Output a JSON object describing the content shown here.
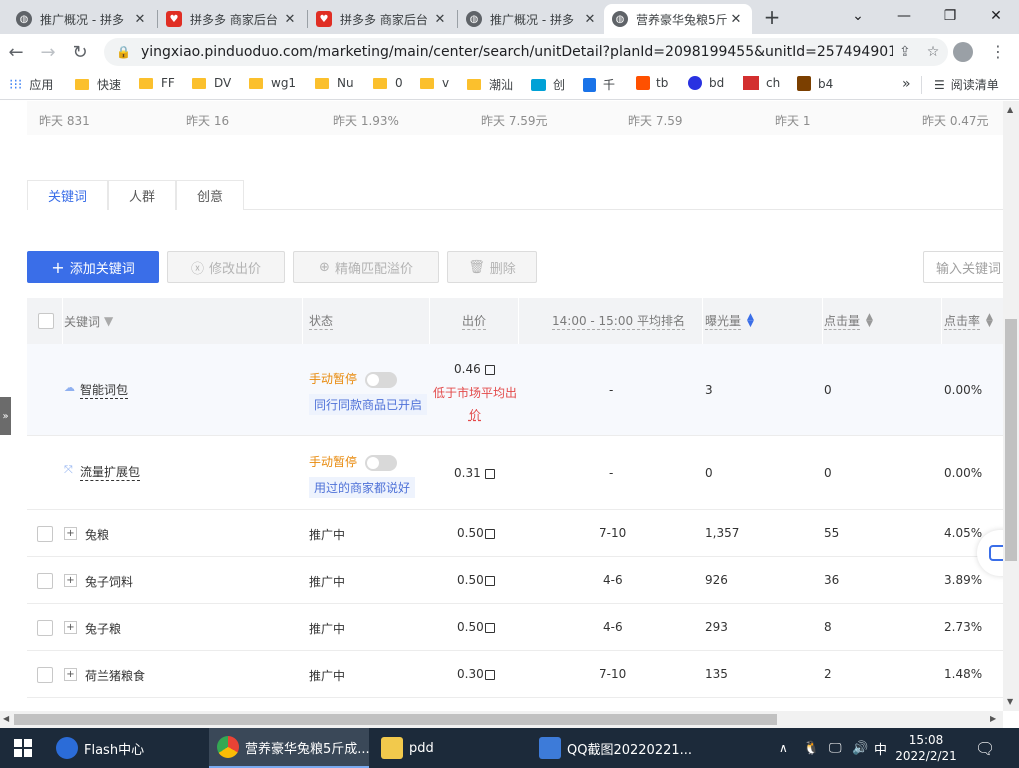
{
  "browser": {
    "tabs": [
      {
        "title": "推广概况 - 拼多",
        "icon": "globe-icon"
      },
      {
        "title": "拼多多 商家后台",
        "icon": "pinduoduo-icon"
      },
      {
        "title": "拼多多 商家后台",
        "icon": "pinduoduo-icon"
      },
      {
        "title": "推广概况 - 拼多",
        "icon": "globe-icon"
      },
      {
        "title": "营养豪华兔粮5斤",
        "icon": "globe-icon",
        "active": true
      }
    ],
    "new_tab": "+",
    "url": "yingxiao.pinduoduo.com/marketing/main/center/search/unitDetail?planId=2098199455&unitId=257494901...",
    "bookmarks": [
      "应用",
      "快速",
      "FF",
      "DV",
      "wg1",
      "Nu",
      "0",
      "v",
      "潮汕",
      "创",
      "千",
      "tb",
      "bd",
      "ch",
      "b4"
    ],
    "bookmarks_more": "»",
    "reading_list": "阅读清单"
  },
  "stats_row": [
    "昨天 831",
    "昨天 16",
    "昨天 1.93%",
    "昨天 7.59元",
    "昨天 7.59",
    "昨天 1",
    "昨天 0.47元"
  ],
  "content_tabs": [
    "关键词",
    "人群",
    "创意"
  ],
  "actions": {
    "add_keyword": "添加关键词",
    "edit_bid": "修改出价",
    "precise_match": "精确匹配溢价",
    "delete": "删除",
    "search_placeholder": "输入关键词"
  },
  "table": {
    "headers": {
      "keyword": "关键词",
      "status": "状态",
      "bid": "出价",
      "avg_rank": "14:00 - 15:00 平均排名",
      "impressions": "曝光量",
      "clicks": "点击量",
      "ctr": "点击率"
    },
    "special_rows": [
      {
        "name": "智能词包",
        "status": "手动暂停",
        "tag": "同行同款商品已开启",
        "bid": "0.46",
        "note_line1": "低于市场平均出",
        "note_line2": "价",
        "rank": "-",
        "impressions": "3",
        "clicks": "0",
        "ctr": "0.00%"
      },
      {
        "name": "流量扩展包",
        "status": "手动暂停",
        "tag": "用过的商家都说好",
        "bid": "0.31",
        "rank": "-",
        "impressions": "0",
        "clicks": "0",
        "ctr": "0.00%"
      }
    ],
    "rows": [
      {
        "name": "兔粮",
        "status": "推广中",
        "bid": "0.50",
        "rank": "7-10",
        "impressions": "1,357",
        "clicks": "55",
        "ctr": "4.05%"
      },
      {
        "name": "兔子饲料",
        "status": "推广中",
        "bid": "0.50",
        "rank": "4-6",
        "impressions": "926",
        "clicks": "36",
        "ctr": "3.89%"
      },
      {
        "name": "兔子粮",
        "status": "推广中",
        "bid": "0.50",
        "rank": "4-6",
        "impressions": "293",
        "clicks": "8",
        "ctr": "2.73%"
      },
      {
        "name": "荷兰猪粮食",
        "status": "推广中",
        "bid": "0.30",
        "rank": "7-10",
        "impressions": "135",
        "clicks": "2",
        "ctr": "1.48%"
      }
    ]
  },
  "taskbar": {
    "items": [
      "Flash中心",
      "营养豪华兔粮5斤成...",
      "pdd",
      "QQ截图20220221..."
    ],
    "ime": "中",
    "time": "15:08",
    "date": "2022/2/21"
  },
  "colors": {
    "accent": "#3a6ee8",
    "paused": "#e88a0c",
    "warning": "#e34a4a",
    "taskbar": "#1c2a3a"
  }
}
